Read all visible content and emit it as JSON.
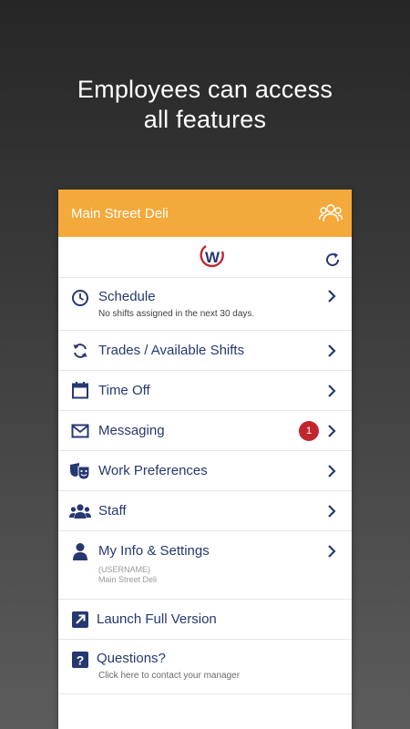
{
  "promo": {
    "line1": "Employees can access",
    "line2": "all features"
  },
  "header": {
    "title": "Main Street Deli",
    "icon": "people-icon"
  },
  "logo": {
    "letter": "W"
  },
  "menu": {
    "schedule": {
      "label": "Schedule",
      "sub": "No shifts assigned in the next 30 days."
    },
    "trades": {
      "label": "Trades / Available Shifts"
    },
    "timeoff": {
      "label": "Time Off"
    },
    "messaging": {
      "label": "Messaging",
      "badge": "1"
    },
    "workprefs": {
      "label": "Work Preferences"
    },
    "staff": {
      "label": "Staff"
    },
    "myinfo": {
      "label": "My Info & Settings",
      "username": "(USERNAME)",
      "location": "Main Street Deli"
    },
    "launch": {
      "label": "Launch Full Version"
    },
    "questions": {
      "label": "Questions?",
      "sub": "Click here to contact your manager"
    }
  },
  "colors": {
    "accent": "#f4a93b",
    "navy": "#263870",
    "badge": "#c0272d"
  }
}
